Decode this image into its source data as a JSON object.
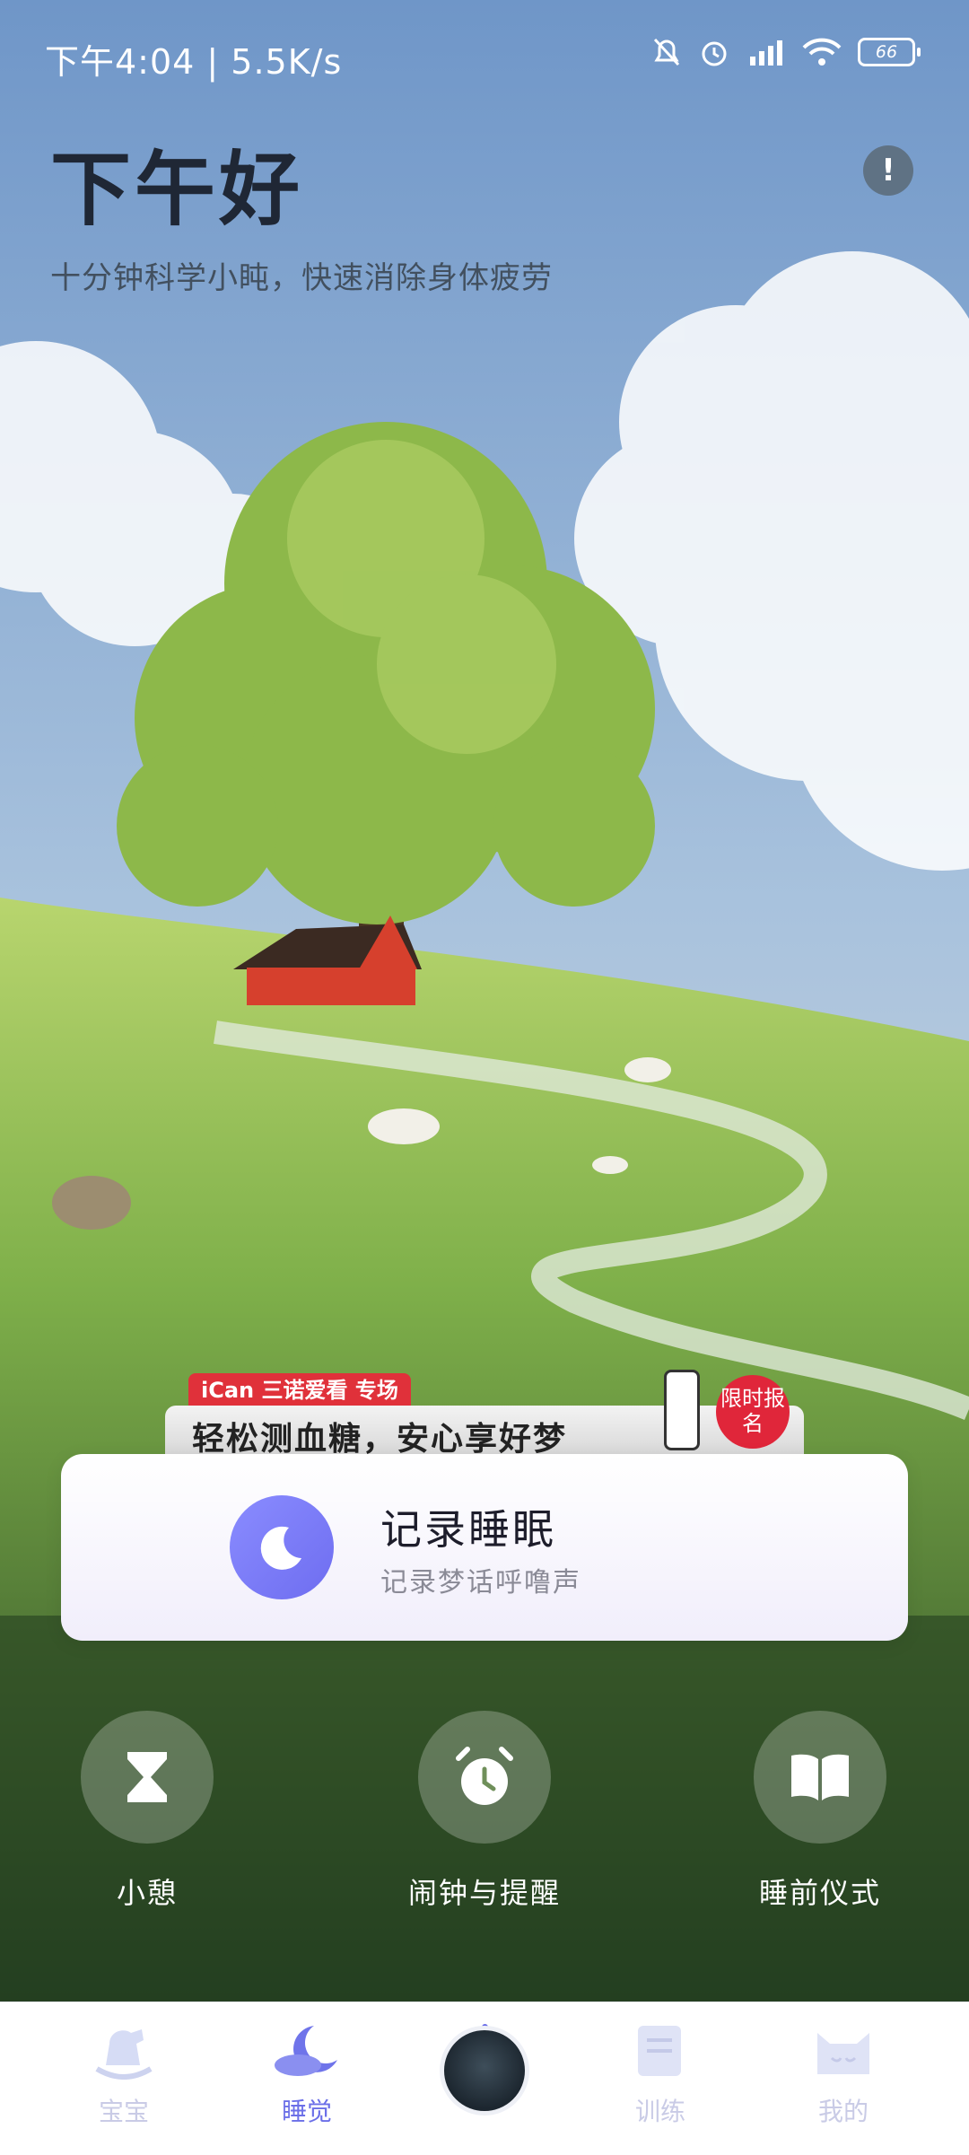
{
  "status_bar": {
    "time": "下午4:04 | 5.5K/s",
    "battery": "66"
  },
  "header": {
    "greeting": "下午好",
    "subtitle": "十分钟科学小盹，快速消除身体疲劳",
    "info_symbol": "!"
  },
  "promo": {
    "tag": "iCan 三诺爱看 专场",
    "text": "轻松测血糖，安心享好梦",
    "badge": "限时报名"
  },
  "record_card": {
    "title": "记录睡眠",
    "subtitle": "记录梦话呼噜声"
  },
  "actions": [
    {
      "label": "小憩",
      "icon": "hourglass-icon"
    },
    {
      "label": "闹钟与提醒",
      "icon": "alarm-icon"
    },
    {
      "label": "睡前仪式",
      "icon": "book-icon"
    }
  ],
  "nav": {
    "items": [
      {
        "label": "宝宝",
        "icon": "rocking-horse-icon"
      },
      {
        "label": "睡觉",
        "icon": "moon-cloud-icon",
        "active": true
      },
      {
        "label": "",
        "icon": "sound-disc-icon"
      },
      {
        "label": "训练",
        "icon": "notebook-icon"
      },
      {
        "label": "我的",
        "icon": "cat-icon"
      }
    ]
  },
  "colors": {
    "accent": "#6b6fe8",
    "inactive": "#c9cbe6",
    "promo_red": "#e0313a"
  }
}
